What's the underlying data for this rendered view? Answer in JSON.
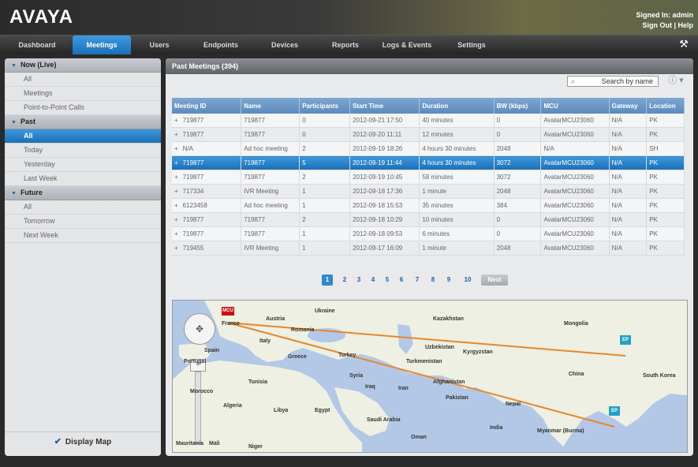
{
  "header": {
    "logo": "AVAYA",
    "signed_in": "Signed In: admin",
    "sign_out": "Sign Out",
    "separator": " | ",
    "help": "Help"
  },
  "nav": {
    "tabs": [
      "Dashboard",
      "Meetings",
      "Users",
      "Endpoints",
      "Devices",
      "Reports",
      "Logs & Events",
      "Settings"
    ],
    "active": "Meetings"
  },
  "sidebar": {
    "sections": [
      {
        "title": "Now (Live)",
        "items": [
          "All",
          "Meetings",
          "Point-to-Point Calls"
        ]
      },
      {
        "title": "Past",
        "items": [
          "All",
          "Today",
          "Yesterday",
          "Last Week"
        ]
      },
      {
        "title": "Future",
        "items": [
          "All",
          "Tomorrow",
          "Next Week"
        ]
      }
    ],
    "selected": "Past / All",
    "display_map": "Display Map",
    "display_map_checked": true
  },
  "main": {
    "title": "Past Meetings (394)",
    "search_placeholder": "Search by name",
    "table": {
      "columns": [
        "Meeting ID",
        "Name",
        "Participants",
        "Start Time",
        "Duration",
        "BW (kbps)",
        "MCU",
        "Gateway",
        "Location"
      ],
      "rows": [
        [
          "+",
          "719877",
          "719877",
          "0",
          "2012-09-21 17:50",
          "40 minutes",
          "0",
          "AvatarMCU23060",
          "N/A",
          "PK"
        ],
        [
          "+",
          "719877",
          "719877",
          "0",
          "2012-09-20 11:11",
          "12 minutes",
          "0",
          "AvatarMCU23060",
          "N/A",
          "PK"
        ],
        [
          "+",
          "N/A",
          "Ad hoc meeting",
          "2",
          "2012-09-19 18:26",
          "4 hours 30 minutes",
          "2048",
          "N/A",
          "N/A",
          "SH"
        ],
        [
          "+",
          "719877",
          "719877",
          "5",
          "2012-09-19 11:44",
          "4 hours 30 minutes",
          "3072",
          "AvatarMCU23060",
          "N/A",
          "PK"
        ],
        [
          "+",
          "719877",
          "719877",
          "2",
          "2012-09-19 10:45",
          "58 minutes",
          "3072",
          "AvatarMCU23060",
          "N/A",
          "PK"
        ],
        [
          "+",
          "717334",
          "IVR Meeting",
          "1",
          "2012-09-18 17:36",
          "1 minute",
          "2048",
          "AvatarMCU23060",
          "N/A",
          "PK"
        ],
        [
          "+",
          "6123458",
          "Ad hoc meeting",
          "1",
          "2012-09-18 15:53",
          "35 minutes",
          "384",
          "AvatarMCU23060",
          "N/A",
          "PK"
        ],
        [
          "+",
          "719877",
          "719877",
          "2",
          "2012-09-18 10:29",
          "10 minutes",
          "0",
          "AvatarMCU23060",
          "N/A",
          "PK"
        ],
        [
          "+",
          "719877",
          "719877",
          "1",
          "2012-09-18 09:53",
          "6 minutes",
          "0",
          "AvatarMCU23060",
          "N/A",
          "PK"
        ],
        [
          "+",
          "719455",
          "IVR Meeting",
          "1",
          "2012-09-17 16:09",
          "1 minute",
          "2048",
          "AvatarMCU23060",
          "N/A",
          "PK"
        ]
      ],
      "selected_row": 3
    },
    "pagination": {
      "pages": [
        "1",
        "2",
        "3",
        "4",
        "5",
        "6",
        "7",
        "8",
        "9",
        "10"
      ],
      "current": "1",
      "next": "Next"
    },
    "map": {
      "labels": [
        "Ukraine",
        "Kazakhstan",
        "Mongolia",
        "Austria",
        "France",
        "Romania",
        "Italy",
        "Spain",
        "Greece",
        "Turkey",
        "Uzbekistan",
        "Kyrgyzstan",
        "Turkmenistan",
        "Portugal",
        "Tunisia",
        "Syria",
        "Iraq",
        "Iran",
        "Afghanistan",
        "Pakistan",
        "China",
        "South Korea",
        "Morocco",
        "Algeria",
        "Libya",
        "Egypt",
        "Saudi Arabia",
        "Oman",
        "India",
        "Nepal",
        "Myanmar (Burma)",
        "Mali",
        "Mauritania",
        "Niger"
      ],
      "markers": {
        "mcu": "MCU",
        "endpoint": "EP"
      },
      "line_color": "#e8862a",
      "water_color": "#b3c8e6",
      "land_color": "#eef0e3"
    }
  }
}
